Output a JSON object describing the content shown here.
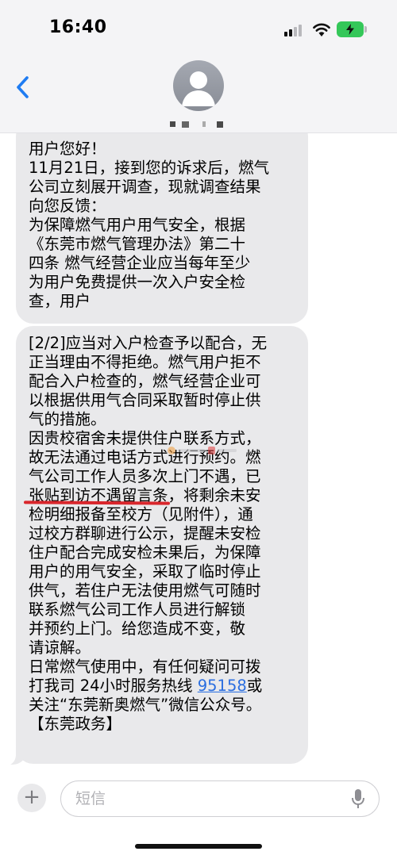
{
  "status_bar": {
    "time": "16:40"
  },
  "header": {
    "back_label": "<",
    "contact_name": ""
  },
  "messages": [
    {
      "lines": [
        "用户您好！",
        "11月21日，接到您的诉求后，燃气",
        "公司立刻展开调查，现就调查结果",
        "向您反馈：",
        "为保障燃气用户用气安全，根据",
        "《东莞市燃气管理办法》第二十",
        "四条 燃气经营企业应当每年至少",
        "为用户免费提供一次入户安全检",
        "查，用户"
      ]
    },
    {
      "lines_before_mark": [
        "[2/2]应当对入户检查予以配合，无",
        "正当理由不得拒绝。燃气用户拒不",
        "配合入户检查的，燃气经营企业可",
        "以根据供用气合同采取暂时停止供",
        "气的措施。",
        "因贵校宿舍未提供住户联系方式，",
        "故无法通过电话方式进行预约。燃",
        "气公司工作人员多次上门不遇，已"
      ],
      "marked_text": "张贴到访不遇留言条",
      "marked_line_rest": "，将剩余未安",
      "lines_after_mark": [
        "检明细报备至校方（见附件），通",
        "过校方群聊进行公示，提醒未安检",
        "住户配合完成安检未果后，为保障",
        "用户的用气安全，采取了临时停止",
        "供气，若住户无法使用燃气可随时",
        "联系燃气公司工作人员进行解锁",
        "并预约上门。给您造成不变，敬",
        "请谅解。",
        "日常燃气使用中，有任何疑问可拨"
      ],
      "hotline_prefix": "打我司 24小时服务热线 ",
      "hotline_number": "95158",
      "hotline_suffix": "或",
      "final_lines": [
        "关注“东莞新奥燃气”微信公众号。",
        "【东莞政务】"
      ]
    }
  ],
  "composer": {
    "placeholder": "短信",
    "plus_label": "+"
  },
  "colors": {
    "bubble": "#e9e9eb",
    "link": "#2a6ee0",
    "annotation": "#d9262c",
    "battery": "#34c759",
    "ios_blue": "#1f7cf2"
  },
  "icons": [
    "back-chevron-icon",
    "avatar-icon",
    "signal-icon",
    "wifi-icon",
    "battery-icon",
    "plus-icon",
    "microphone-icon"
  ]
}
